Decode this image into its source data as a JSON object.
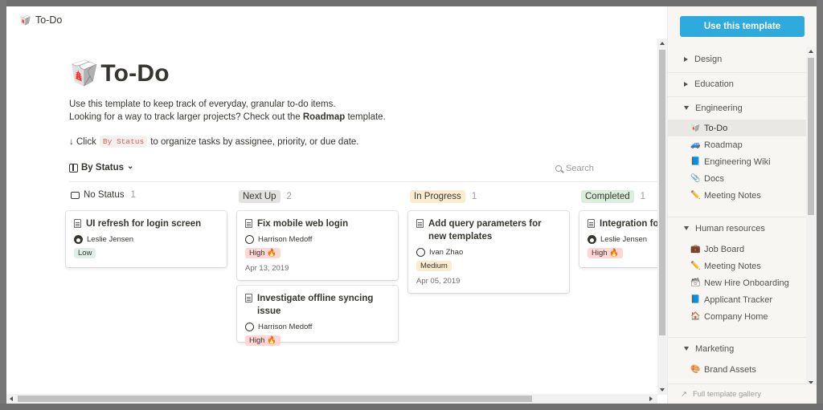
{
  "breadcrumb": {
    "icon": "todo-emoji",
    "emoji": "🥡",
    "title": "To-Do"
  },
  "page": {
    "icon": "todo-emoji",
    "emoji": "🥡",
    "title": "To-Do",
    "desc_line1": "Use this template to keep track of everyday, granular to-do items.",
    "desc_line2_pre": "Looking for a way to track larger projects? Check out the ",
    "desc_line2_bold": "Roadmap",
    "desc_line2_post": " template.",
    "hint_pre": "↓ Click",
    "hint_code": "By Status",
    "hint_post": "to organize tasks by assignee, priority, or due date."
  },
  "view": {
    "label": "By Status",
    "chevron": "⌄",
    "search_placeholder": "Search"
  },
  "columns": [
    {
      "label": "No Status",
      "count": "1",
      "color": ""
    },
    {
      "label": "Next Up",
      "count": "2",
      "color": "#e3e2e0"
    },
    {
      "label": "In Progress",
      "count": "1",
      "color": "#fbeccf"
    },
    {
      "label": "Completed",
      "count": "1",
      "color": "#dbeddb"
    }
  ],
  "cards": [
    {
      "title": "UI refresh for login screen",
      "person": "Leslie Jensen",
      "priority": "Low",
      "date": ""
    },
    {
      "title": "Fix mobile web login",
      "person": "Harrison Medoff",
      "priority": "High 🔥",
      "date": "Apr 13, 2019"
    },
    {
      "title": "Investigate offline syncing issue",
      "person": "Harrison Medoff",
      "priority": "High 🔥",
      "date": ""
    },
    {
      "title": "Add query parameters for new templates",
      "person": "Ivan Zhao",
      "priority": "Medium",
      "date": "Apr 05, 2019"
    },
    {
      "title": "Integration for",
      "person": "Leslie Jensen",
      "priority": "High 🔥",
      "date": ""
    }
  ],
  "sidebar": {
    "use_button": "Use this template",
    "categories": [
      "Design",
      "Education",
      "Engineering",
      "Human resources",
      "Marketing"
    ],
    "engineering_items": [
      {
        "emoji": "🥡",
        "label": "To-Do"
      },
      {
        "emoji": "🚙",
        "label": "Roadmap"
      },
      {
        "emoji": "📘",
        "label": "Engineering Wiki"
      },
      {
        "emoji": "📎",
        "label": "Docs"
      },
      {
        "emoji": "✏️",
        "label": "Meeting Notes"
      }
    ],
    "hr_items": [
      {
        "emoji": "💼",
        "label": "Job Board"
      },
      {
        "emoji": "✏️",
        "label": "Meeting Notes"
      },
      {
        "emoji": "🗃",
        "label": "New Hire Onboarding"
      },
      {
        "emoji": "📘",
        "label": "Applicant Tracker"
      },
      {
        "emoji": "🏠",
        "label": "Company Home"
      }
    ],
    "marketing_items": [
      {
        "emoji": "🎨",
        "label": "Brand Assets"
      }
    ],
    "gallery_arrow": "↗",
    "gallery_link": "Full template gallery"
  },
  "colors": {
    "accent": "#2eaadc",
    "low": "#dfeee7",
    "high": "#ffd6d6",
    "medium": "#fbeccf"
  }
}
